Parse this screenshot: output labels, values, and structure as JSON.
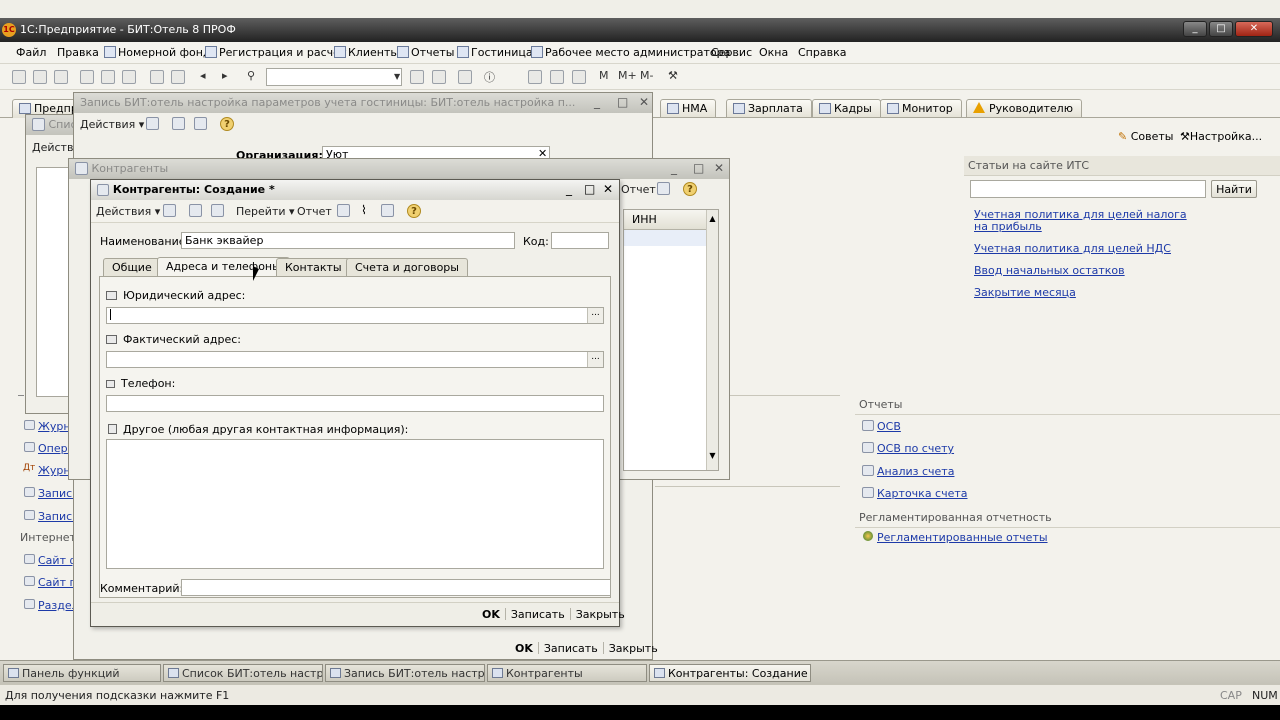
{
  "app": {
    "title": "1С:Предприятие - БИТ:Отель 8 ПРОФ",
    "icon": "1С"
  },
  "menu": [
    "Файл",
    "Правка",
    "Номерной фонд",
    "Регистрация и расчет",
    "Клиенты",
    "Отчеты",
    "Гостиница",
    "Рабочее место администратора",
    "Сервис",
    "Окна",
    "Справка"
  ],
  "tabs": {
    "t1": "НМА",
    "t2": "Зарплата",
    "t3": "Кадры",
    "t4": "Монитор",
    "t5": "Руководителю",
    "left": "Предпр"
  },
  "header_actions": {
    "tips": "Советы",
    "settings": "Настройка..."
  },
  "its": {
    "header": "Статьи на сайте ИТС",
    "find": "Найти",
    "links": [
      "Учетная политика для целей налога",
      "на прибыль",
      "Учетная политика для целей НДС",
      "Ввод начальных остатков",
      "Закрытие месяца"
    ]
  },
  "reports": {
    "header": "Отчеты",
    "links": [
      "ОСВ",
      "ОСВ по счету",
      "Анализ счета",
      "Карточка счета"
    ],
    "reg_header": "Регламентированная отчетность",
    "reg_link": "Регламентированные отчеты"
  },
  "left_panel": {
    "items": [
      "Журн",
      "Опера",
      "Журн",
      "Запись",
      "Запись"
    ],
    "internet": "Интернет",
    "inet_items": [
      "Сайт ф",
      "Сайт п",
      "Раздел"
    ]
  },
  "win_settings": {
    "title": "Запись БИТ:отель настройка параметров учета гостиницы: БИТ:отель настройка п...",
    "actions": "Действия",
    "org_label": "Организация:",
    "org_value": "Уют",
    "ok": "OK",
    "save": "Записать",
    "close": "Закрыть"
  },
  "win_list": {
    "title": "Контрагенты",
    "col_inn": "ИНН",
    "report": "Отчет"
  },
  "win_small": {
    "actions": "Действ",
    "label": "Спис"
  },
  "form": {
    "title": "Контрагенты: Создание *",
    "toolbar": {
      "actions": "Действия",
      "goto": "Перейти",
      "report": "Отчет"
    },
    "name_label": "Наименование:",
    "name_value": "Банк эквайер",
    "code_label": "Код:",
    "code_value": "",
    "tabs": [
      "Общие",
      "Адреса и телефоны",
      "Контакты",
      "Счета и договоры"
    ],
    "legal_address": "Юридический адрес:",
    "actual_address": "Фактический адрес:",
    "phone": "Телефон:",
    "other": "Другое (любая другая контактная информация):",
    "comment": "Комментарий:",
    "ok": "OK",
    "save": "Записать",
    "close": "Закрыть"
  },
  "taskbar": [
    "Панель функций",
    "Список БИТ:отель настрой...",
    "Запись БИТ:отель настр...",
    "Контрагенты",
    "Контрагенты: Создание *"
  ],
  "status": {
    "hint": "Для получения подсказки нажмите F1",
    "cap": "CAP",
    "num": "NUM"
  }
}
